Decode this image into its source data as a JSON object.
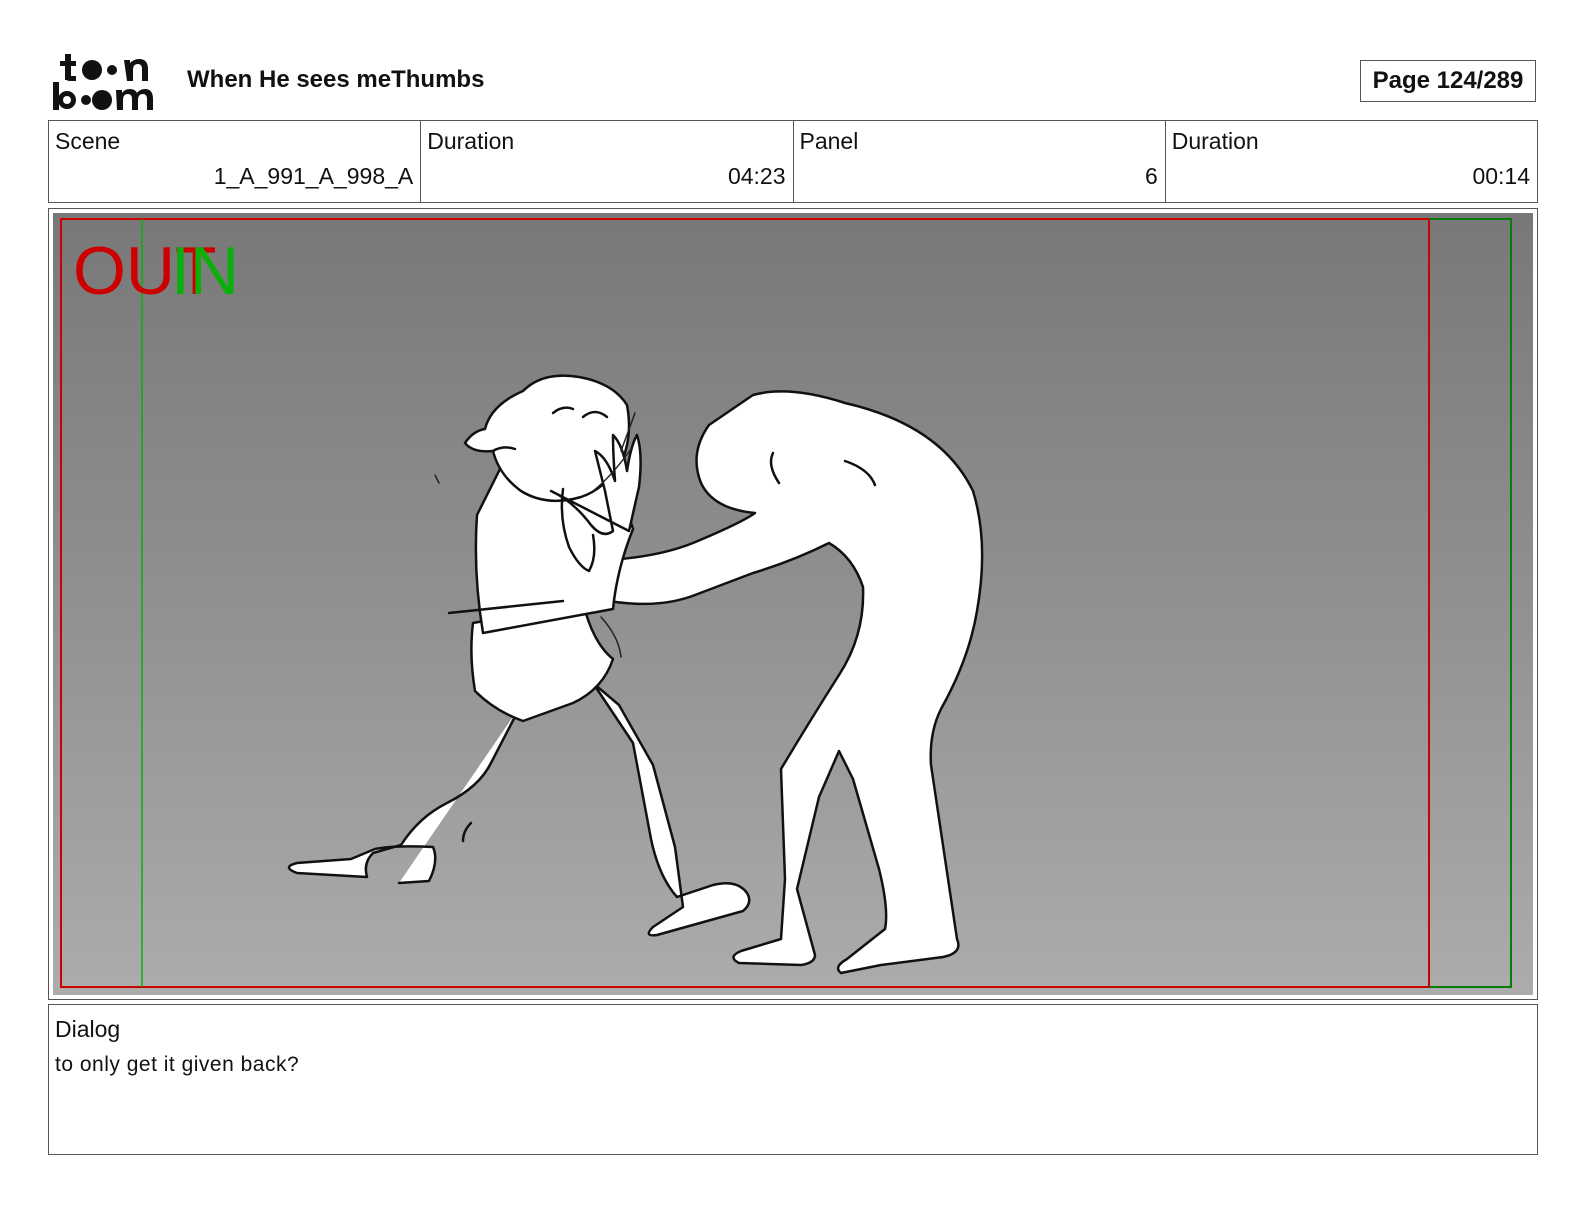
{
  "header": {
    "logo_text": "toon boom",
    "document_title": "When He sees meThumbs",
    "page_indicator": "Page 124/289"
  },
  "meta": {
    "scene_label": "Scene",
    "scene_value": "1_A_991_A_998_A",
    "scene_duration_label": "Duration",
    "scene_duration_value": "04:23",
    "panel_label": "Panel",
    "panel_value": "6",
    "panel_duration_label": "Duration",
    "panel_duration_value": "00:14"
  },
  "panel": {
    "out_label": "OUT",
    "in_label": "IN",
    "out_frame_color": "#cc0000",
    "in_frame_color": "#0ab00a"
  },
  "dialog": {
    "label": "Dialog",
    "text": "to only get it given back?"
  }
}
